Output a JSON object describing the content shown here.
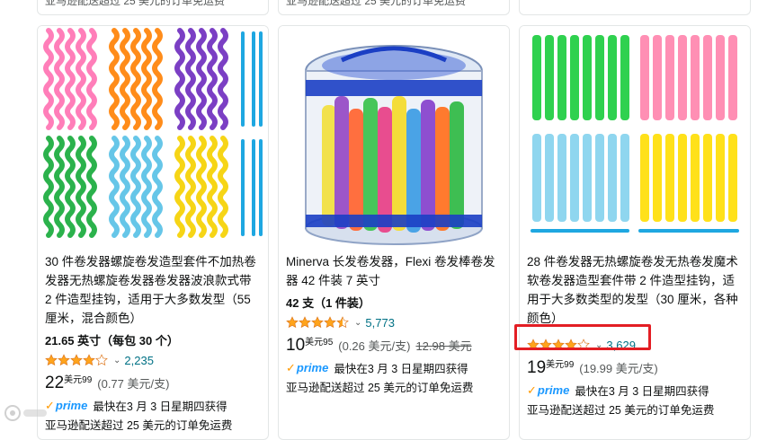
{
  "top_strip": {
    "left": "亚马逊配送超过 25 美元的订单免运费",
    "middle": "亚马逊配送超过 25 美元的订单免运费",
    "right": ""
  },
  "products": [
    {
      "title": "30 件卷发器螺旋卷发造型套件不加热卷发器无热螺旋卷发器卷发器波浪款式带 2 件造型挂钩，适用于大多数发型（55 厘米，混合颜色）",
      "size": "21.65 英寸（每包 30 个）",
      "rating": 4.0,
      "review_count": "2,235",
      "price_whole": "22",
      "price_unit": "美元99",
      "unit_price": "(0.77 美元/支)",
      "list_price": "",
      "prime_label": "prime",
      "delivery": "最快在3 月 3 日星期四获得",
      "shipping": "亚马逊配送超过 25 美元的订单免运费"
    },
    {
      "title": "Minerva 长发卷发器，Flexi 卷发棒卷发器 42 件装 7 英寸",
      "size": "42 支（1 件装）",
      "rating": 4.5,
      "review_count": "5,773",
      "price_whole": "10",
      "price_unit": "美元95",
      "unit_price": "(0.26 美元/支)",
      "list_price": "12.98 美元",
      "prime_label": "prime",
      "delivery": "最快在3 月 3 日星期四获得",
      "shipping": "亚马逊配送超过 25 美元的订单免运费"
    },
    {
      "title": "28 件卷发器无热螺旋卷发无热卷发魔术软卷发器造型套件带 2 件造型挂钩，适用于大多数类型的发型（30 厘米，各种颜色）",
      "size": "",
      "rating": 4.0,
      "review_count": "3,629",
      "price_whole": "19",
      "price_unit": "美元99",
      "unit_price": "(19.99 美元/支)",
      "list_price": "",
      "prime_label": "prime",
      "delivery": "最快在3 月 3 日星期四获得",
      "shipping": "亚马逊配送超过 25 美元的订单免运费"
    }
  ],
  "colors": {
    "star": "#ffa41c",
    "link": "#007185",
    "prime": "#1a98ff",
    "highlight": "#e31e24"
  }
}
